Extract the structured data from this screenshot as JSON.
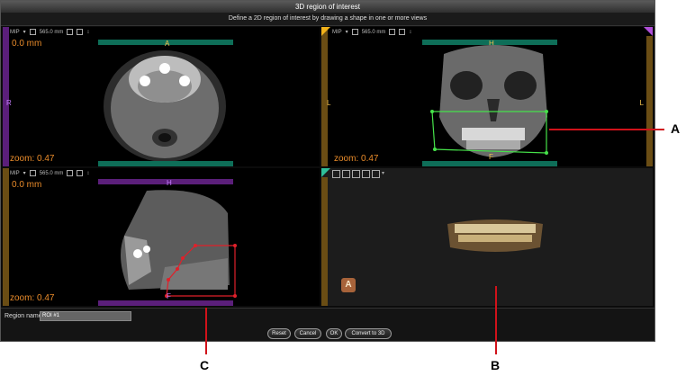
{
  "window": {
    "title": "3D region of interest",
    "subtitle": "Define a 2D region of interest by drawing a shape in one or more views"
  },
  "viewports": {
    "axial": {
      "toolbar": {
        "mode": "MIP",
        "thickness": "565.0 mm"
      },
      "depth": "0.0 mm",
      "zoom": "zoom: 0.47",
      "orient_top": "A",
      "orient_left": "R"
    },
    "coronal": {
      "toolbar": {
        "mode": "MIP",
        "thickness": "565.0 mm"
      },
      "orient_top": "H",
      "orient_bottom": "F",
      "orient_left": "L",
      "orient_right": "L",
      "zoom": "zoom: 0.47"
    },
    "sagittal": {
      "toolbar": {
        "mode": "MIP",
        "thickness": "565.0 mm"
      },
      "depth": "0.0 mm",
      "zoom": "zoom: 0.47",
      "orient_top": "H",
      "orient_bottom": "F"
    },
    "three_d": {
      "badge": "A"
    }
  },
  "region": {
    "label": "Region name:",
    "value": "ROI #1"
  },
  "buttons": {
    "reset": "Reset",
    "cancel": "Cancel",
    "ok": "OK",
    "convert": "Convert to 3D"
  },
  "callouts": {
    "a": "A",
    "b": "B",
    "c": "C"
  },
  "colors": {
    "orange": "#e98b2a",
    "teal": "#2fbf9a",
    "purple": "#b04fd8",
    "roi_green": "#46e24a",
    "roi_red": "#e0202a"
  }
}
